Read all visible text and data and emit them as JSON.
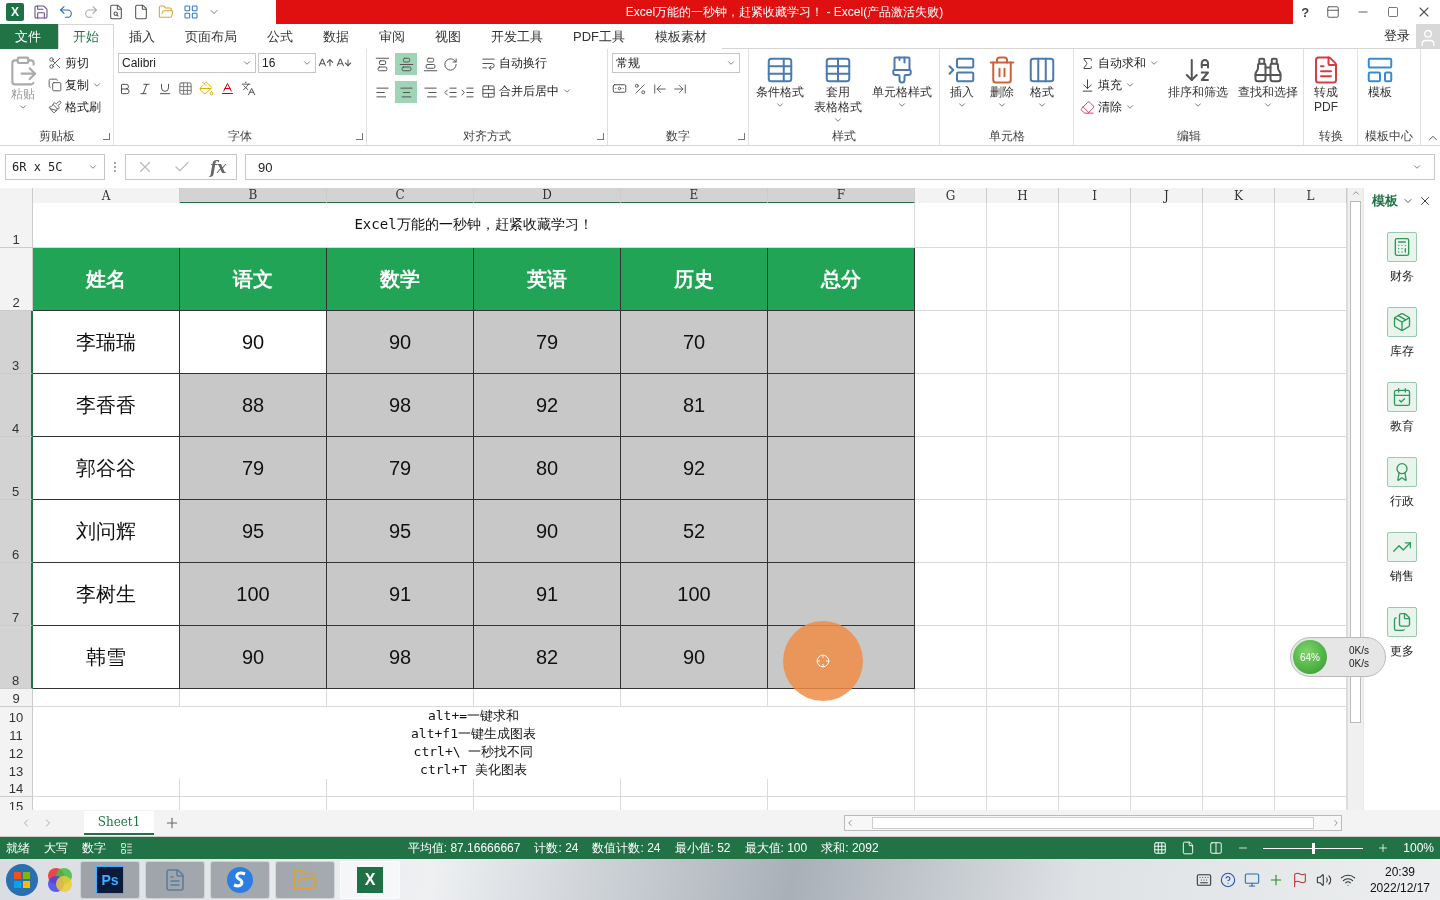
{
  "app_icon": "X",
  "window": {
    "title": "Excel万能的一秒钟，赶紧收藏学习！ - Excel(产品激活失败)",
    "help": "?"
  },
  "ribbon_tabs": [
    {
      "label": "文件",
      "kind": "file",
      "selected": false
    },
    {
      "label": "开始",
      "kind": "tab",
      "selected": true
    },
    {
      "label": "插入",
      "kind": "tab",
      "selected": false
    },
    {
      "label": "页面布局",
      "kind": "tab",
      "selected": false
    },
    {
      "label": "公式",
      "kind": "tab",
      "selected": false
    },
    {
      "label": "数据",
      "kind": "tab",
      "selected": false
    },
    {
      "label": "审阅",
      "kind": "tab",
      "selected": false
    },
    {
      "label": "视图",
      "kind": "tab",
      "selected": false
    },
    {
      "label": "开发工具",
      "kind": "tab",
      "selected": false
    },
    {
      "label": "PDF工具",
      "kind": "tab",
      "selected": false
    },
    {
      "label": "模板素材",
      "kind": "tab",
      "selected": false
    }
  ],
  "account": {
    "label": "登录"
  },
  "ribbon": {
    "clipboard": {
      "title": "剪贴板",
      "paste": {
        "label": "粘贴",
        "disabled": true
      },
      "items": [
        {
          "label": "剪切",
          "dropdown": false
        },
        {
          "label": "复制",
          "dropdown": true
        },
        {
          "label": "格式刷",
          "dropdown": false
        }
      ]
    },
    "font": {
      "title": "字体",
      "font_name": "Calibri",
      "font_size": "16"
    },
    "align": {
      "title": "对齐方式",
      "vertical": [
        {
          "selected": false
        },
        {
          "selected": true
        },
        {
          "selected": false
        }
      ],
      "horizontal": [
        {
          "selected": false
        },
        {
          "selected": true
        },
        {
          "selected": false
        }
      ],
      "wrap": "自动换行",
      "merge": "合并后居中"
    },
    "number": {
      "title": "数字",
      "format": "常规"
    },
    "styles": {
      "title": "样式",
      "buttons": [
        {
          "lines": [
            "条件格式"
          ],
          "dropdown": true
        },
        {
          "lines": [
            "套用",
            "表格格式"
          ],
          "dropdown": true
        },
        {
          "lines": [
            "单元格样式"
          ],
          "dropdown": true
        }
      ]
    },
    "cells": {
      "title": "单元格",
      "buttons": [
        {
          "lines": [
            "插入"
          ],
          "dropdown": true
        },
        {
          "lines": [
            "删除"
          ],
          "dropdown": true
        },
        {
          "lines": [
            "格式"
          ],
          "dropdown": true
        }
      ]
    },
    "editing": {
      "title": "编辑",
      "small": [
        {
          "label": "自动求和",
          "dropdown": true
        },
        {
          "label": "填充",
          "dropdown": true
        },
        {
          "label": "清除",
          "dropdown": true
        }
      ],
      "buttons": [
        {
          "lines": [
            "排序和筛选"
          ],
          "dropdown": true
        },
        {
          "lines": [
            "查找和选择"
          ],
          "dropdown": true
        }
      ]
    },
    "convert": {
      "title": "转换",
      "buttons": [
        {
          "lines": [
            "转成",
            "PDF"
          ],
          "dropdown": false
        }
      ]
    },
    "template": {
      "title": "模板中心",
      "buttons": [
        {
          "lines": [
            "模板"
          ],
          "dropdown": false
        }
      ]
    }
  },
  "formula_bar": {
    "name_box": "6R x 5C",
    "fx_label": "fx",
    "value": "90"
  },
  "sheet": {
    "columns": [
      {
        "label": "A",
        "selected": false
      },
      {
        "label": "B",
        "selected": true
      },
      {
        "label": "C",
        "selected": true
      },
      {
        "label": "D",
        "selected": true
      },
      {
        "label": "E",
        "selected": true
      },
      {
        "label": "F",
        "selected": true
      },
      {
        "label": "G",
        "selected": false
      },
      {
        "label": "H",
        "selected": false
      },
      {
        "label": "I",
        "selected": false
      },
      {
        "label": "J",
        "selected": false
      },
      {
        "label": "K",
        "selected": false
      },
      {
        "label": "L",
        "selected": false
      }
    ],
    "rows": [
      {
        "number": "1",
        "selected": false,
        "kind": "title",
        "text": "Excel万能的一秒钟，赶紧收藏学习！"
      },
      {
        "number": "2",
        "selected": false,
        "kind": "header",
        "cells": [
          "姓名",
          "语文",
          "数学",
          "英语",
          "历史",
          "总分"
        ]
      },
      {
        "number": "3",
        "selected": true,
        "kind": "data",
        "cells": [
          {
            "text": "李瑞瑞",
            "selected": false
          },
          {
            "text": "90",
            "selected": false
          },
          {
            "text": "90",
            "selected": true
          },
          {
            "text": "79",
            "selected": true
          },
          {
            "text": "70",
            "selected": true
          },
          {
            "selected": true
          }
        ]
      },
      {
        "number": "4",
        "selected": true,
        "kind": "data",
        "cells": [
          {
            "text": "李香香",
            "selected": false
          },
          {
            "text": "88",
            "selected": true
          },
          {
            "text": "98",
            "selected": true
          },
          {
            "text": "92",
            "selected": true
          },
          {
            "text": "81",
            "selected": true
          },
          {
            "selected": true
          }
        ]
      },
      {
        "number": "5",
        "selected": true,
        "kind": "data",
        "cells": [
          {
            "text": "郭谷谷",
            "selected": false
          },
          {
            "text": "79",
            "selected": true
          },
          {
            "text": "79",
            "selected": true
          },
          {
            "text": "80",
            "selected": true
          },
          {
            "text": "92",
            "selected": true
          },
          {
            "selected": true
          }
        ]
      },
      {
        "number": "6",
        "selected": true,
        "kind": "data",
        "cells": [
          {
            "text": "刘问辉",
            "selected": false
          },
          {
            "text": "95",
            "selected": true
          },
          {
            "text": "95",
            "selected": true
          },
          {
            "text": "90",
            "selected": true
          },
          {
            "text": "52",
            "selected": true
          },
          {
            "selected": true
          }
        ]
      },
      {
        "number": "7",
        "selected": true,
        "kind": "data",
        "cells": [
          {
            "text": "李树生",
            "selected": false
          },
          {
            "text": "100",
            "selected": true
          },
          {
            "text": "91",
            "selected": true
          },
          {
            "text": "91",
            "selected": true
          },
          {
            "text": "100",
            "selected": true
          },
          {
            "selected": true
          }
        ]
      },
      {
        "number": "8",
        "selected": true,
        "kind": "data",
        "cells": [
          {
            "text": "韩雪",
            "selected": false
          },
          {
            "text": "90",
            "selected": true
          },
          {
            "text": "98",
            "selected": true
          },
          {
            "text": "82",
            "selected": true
          },
          {
            "text": "90",
            "selected": true
          },
          {
            "selected": true
          }
        ]
      },
      {
        "number": "9",
        "selected": false,
        "kind": "blank"
      },
      {
        "number": "10",
        "selected": false,
        "kind": "note",
        "text": "alt+=一键求和"
      },
      {
        "number": "11",
        "selected": false,
        "kind": "note",
        "text": "alt+f1一键生成图表"
      },
      {
        "number": "12",
        "selected": false,
        "kind": "note",
        "text": "ctrl+\\ 一秒找不同"
      },
      {
        "number": "13",
        "selected": false,
        "kind": "note",
        "text": "ctrl+T 美化图表"
      },
      {
        "number": "14",
        "selected": false,
        "kind": "blank"
      },
      {
        "number": "15",
        "selected": false,
        "kind": "blank"
      }
    ]
  },
  "side_panel": {
    "title": "模板",
    "items": [
      "财务",
      "库存",
      "教育",
      "行政",
      "销售",
      "更多"
    ]
  },
  "net_widget": {
    "percent": "64%",
    "up": "0K/s",
    "down": "0K/s"
  },
  "sheet_tabs": [
    {
      "label": "Sheet1",
      "selected": true
    }
  ],
  "status_bar": {
    "mode": "就绪",
    "caps": "大写",
    "num": "数字",
    "stats": [
      "平均值: 87.16666667",
      "计数: 24",
      "数值计数: 24",
      "最小值: 52",
      "最大值: 100",
      "求和: 2092"
    ],
    "zoom": "100%",
    "zoom_slider": {
      "level": 0.5
    }
  },
  "taskbar": {
    "apps": [
      {
        "kind": "start"
      },
      {
        "kind": "picasa"
      },
      {
        "kind": "ps",
        "glyph": "Ps",
        "selected": false
      },
      {
        "kind": "notes",
        "selected": false
      },
      {
        "kind": "sogou",
        "selected": false
      },
      {
        "kind": "folder",
        "selected": false
      },
      {
        "kind": "excel",
        "glyph": "X",
        "selected": true
      }
    ],
    "time": "20:39",
    "date": "2022/12/17"
  }
}
